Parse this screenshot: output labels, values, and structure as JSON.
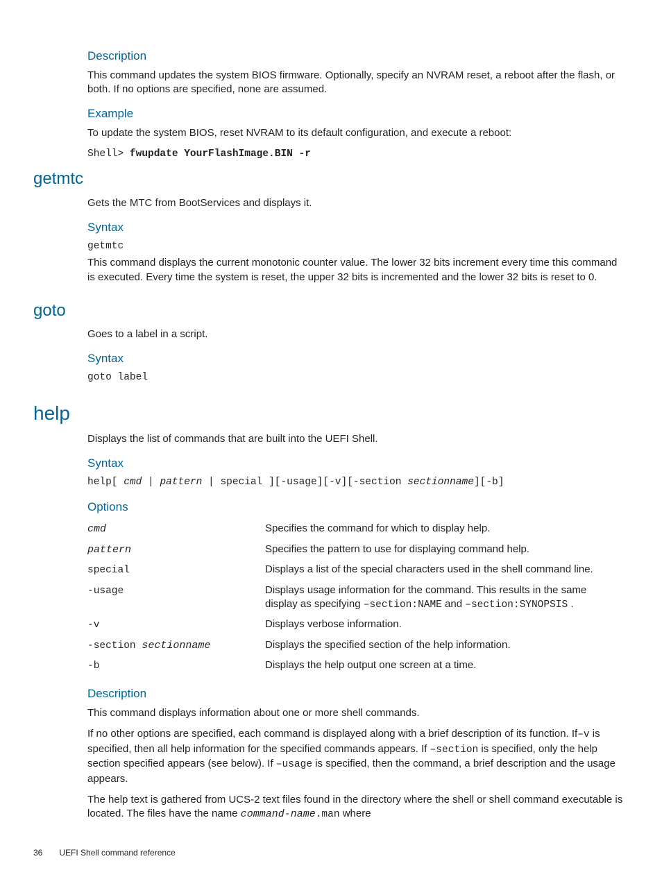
{
  "fwupdate": {
    "desc_h": "Description",
    "desc_p": "This command updates the system BIOS firmware. Optionally, specify an NVRAM reset, a reboot after the flash, or both. If no options are specified, none are assumed.",
    "ex_h": "Example",
    "ex_p": "To update the system BIOS, reset NVRAM to its default configuration, and execute a reboot:",
    "ex_prompt": "Shell> ",
    "ex_cmd": "fwupdate YourFlashImage.BIN -r"
  },
  "getmtc": {
    "h": "getmtc",
    "lead": "Gets the MTC from BootServices and displays it.",
    "syntax_h": "Syntax",
    "syntax": "getmtc",
    "p": "This command displays the current monotonic counter value. The lower 32 bits increment every time this command is executed. Every time the system is reset, the upper 32 bits is incremented and the lower 32 bits is reset to 0."
  },
  "goto": {
    "h": "goto",
    "lead": "Goes to a label in a script.",
    "syntax_h": "Syntax",
    "syntax": "goto label"
  },
  "help": {
    "h": "help",
    "lead": "Displays the list of commands that are built into the UEFI Shell.",
    "syntax_h": "Syntax",
    "syntax_pre": "help[ ",
    "syntax_cmd": "cmd",
    "syntax_pipe1": " | ",
    "syntax_pattern": "pattern",
    "syntax_pipe2": " | special ][-usage][-v][-section ",
    "syntax_section": "sectionname",
    "syntax_tail": "][-b]",
    "options_h": "Options",
    "opts": [
      {
        "k": "cmd",
        "ki": true,
        "v": "Specifies the command for which to display help."
      },
      {
        "k": "pattern",
        "ki": true,
        "v": "Specifies the pattern to use for displaying command help."
      },
      {
        "k": "special",
        "v": "Displays a list of the special characters used in the shell command line."
      }
    ],
    "usage_k": "-usage",
    "usage_v1": "Displays usage information for the command. This results in the same display as specifying ",
    "usage_c1": "–section:NAME",
    "usage_v2": " and ",
    "usage_c2": "–section:SYNOPSIS",
    "usage_v3": " .",
    "v_k": "-v",
    "v_v": "Displays verbose information.",
    "sect_k1": "-section ",
    "sect_k2": "sectionname",
    "sect_v": "Displays the specified section of the help information.",
    "b_k": "-b",
    "b_v": "Displays the help output one screen at a time.",
    "desc_h": "Description",
    "desc_p1": "This command displays information about one or more shell commands.",
    "desc_p2a": "If no other options are specified, each command is displayed along with a brief description of its function. If",
    "desc_c_v": "–v",
    "desc_p2b": " is specified, then all help information for the specified commands appears. If ",
    "desc_c_sect": "–section",
    "desc_p2c": " is specified, only the help section specified appears (see below). If ",
    "desc_c_usage": "–usage",
    "desc_p2d": " is specified, then the command, a brief description and the usage appears.",
    "desc_p3a": "The help text is gathered from UCS-2 text files found in the directory where the shell or shell command executable is located. The files have the name ",
    "desc_p3_cmd": "command-name",
    "desc_p3_ext": ".man",
    "desc_p3b": " where"
  },
  "footer": {
    "page": "36",
    "title": "UEFI Shell command reference"
  }
}
